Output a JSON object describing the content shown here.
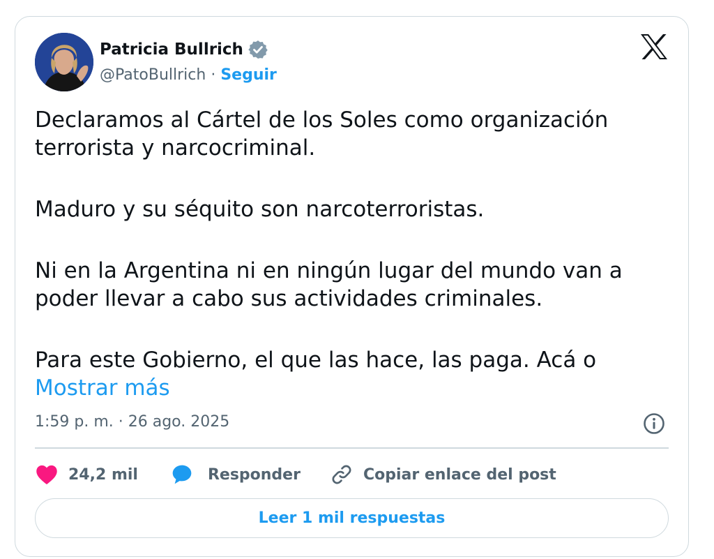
{
  "author": {
    "name": "Patricia Bullrich",
    "handle": "@PatoBullrich",
    "separator": "·",
    "follow_label": "Seguir",
    "verified": true
  },
  "post": {
    "paragraphs": [
      "Declaramos al Cártel de los Soles como organización terrorista y narcocriminal.",
      "Maduro y su séquito son narcoterroristas.",
      "Ni en la Argentina ni en ningún lugar del mundo van a poder llevar a cabo sus actividades criminales.",
      "Para este Gobierno, el que las hace, las paga. Acá o"
    ],
    "show_more_label": "Mostrar más",
    "timestamp": "1:59 p. m. · 26 ago. 2025"
  },
  "actions": {
    "likes": "24,2 mil",
    "reply_label": "Responder",
    "copy_link_label": "Copiar enlace del post"
  },
  "read_replies_label": "Leer 1 mil respuestas",
  "icons": {
    "verified": "verified-badge-icon",
    "brand": "x-logo-icon",
    "info": "info-icon",
    "like": "heart-icon",
    "reply": "speech-bubble-icon",
    "copy": "link-icon"
  },
  "colors": {
    "accent": "#1d9bf0",
    "like": "#f91880",
    "secondary_text": "#536471",
    "border": "#cfd9de",
    "verified_badge": "#829aab"
  }
}
